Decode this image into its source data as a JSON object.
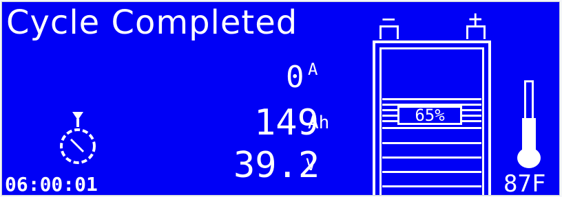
{
  "status": "Cycle Completed",
  "current": {
    "value": "0",
    "unit": "A"
  },
  "capacity": {
    "value": "149",
    "unit": "Ah"
  },
  "voltage": {
    "value": "39.2",
    "unit": "V"
  },
  "timer": "06:00:01",
  "battery": {
    "charge_percent_label": "65%",
    "charge_percent": 65,
    "neg_label": "−",
    "pos_label": "+"
  },
  "temperature": "87F",
  "icons": {
    "timer": "stopwatch-icon",
    "temperature": "thermometer-icon",
    "battery": "battery-icon"
  },
  "colors": {
    "screen": "#0000f6",
    "foreground": "#ffffff",
    "bezel": "#f4f6f8"
  }
}
